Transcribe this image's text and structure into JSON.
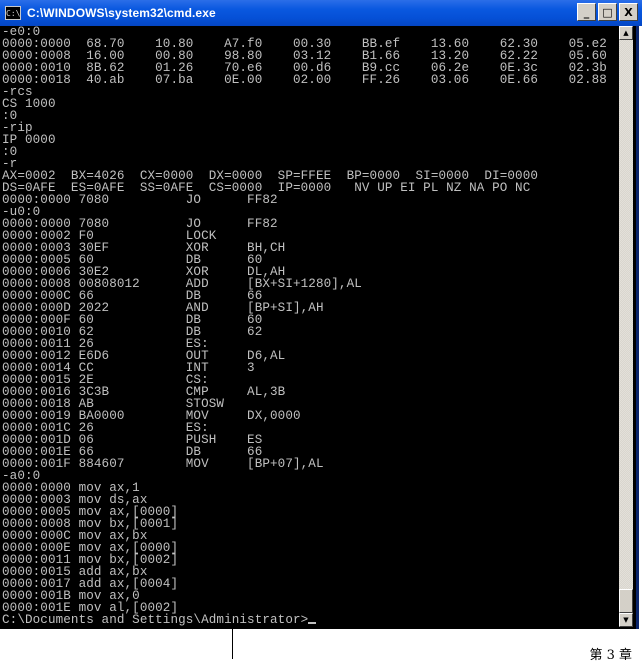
{
  "window": {
    "title": "C:\\WINDOWS\\system32\\cmd.exe",
    "icon_text": "C:\\",
    "buttons": [
      "_",
      "□",
      "X"
    ]
  },
  "console": {
    "lines": [
      "-e0:0",
      "0000:0000  68.70    10.80    A7.f0    00.30    BB.ef    13.60    62.30    05.e2",
      "0000:0008  16.00    00.80    98.80    03.12    B1.66    13.20    62.22    05.60",
      "0000:0010  8B.62    01.26    70.e6    00.d6    B9.cc    06.2e    0E.3c    02.3b",
      "0000:0018  40.ab    07.ba    0E.00    02.00    FF.26    03.06    0E.66    02.88",
      "-rcs",
      "CS 1000",
      ":0",
      "-rip",
      "IP 0000",
      ":0",
      "-r",
      "AX=0002  BX=4026  CX=0000  DX=0000  SP=FFEE  BP=0000  SI=0000  DI=0000",
      "DS=0AFE  ES=0AFE  SS=0AFE  CS=0000  IP=0000   NV UP EI PL NZ NA PO NC",
      "0000:0000 7080          JO      FF82",
      "-u0:0",
      "0000:0000 7080          JO      FF82",
      "0000:0002 F0            LOCK",
      "0000:0003 30EF          XOR     BH,CH",
      "0000:0005 60            DB      60",
      "0000:0006 30E2          XOR     DL,AH",
      "0000:0008 00808012      ADD     [BX+SI+1280],AL",
      "0000:000C 66            DB      66",
      "0000:000D 2022          AND     [BP+SI],AH",
      "0000:000F 60            DB      60",
      "0000:0010 62            DB      62",
      "0000:0011 26            ES:",
      "0000:0012 E6D6          OUT     D6,AL",
      "0000:0014 CC            INT     3",
      "0000:0015 2E            CS:",
      "0000:0016 3C3B          CMP     AL,3B",
      "0000:0018 AB            STOSW",
      "0000:0019 BA0000        MOV     DX,0000",
      "0000:001C 26            ES:",
      "0000:001D 06            PUSH    ES",
      "0000:001E 66            DB      66",
      "0000:001F 884607        MOV     [BP+07],AL",
      "-a0:0",
      "0000:0000 mov ax,1",
      "0000:0003 mov ds,ax",
      "0000:0005 mov ax,[0000]",
      "0000:0008 mov bx,[0001]",
      "0000:000C mov ax,bx",
      "0000:000E mov ax,[0000]",
      "0000:0011 mov bx,[0002]",
      "0000:0015 add ax,bx",
      "0000:0017 add ax,[0004]",
      "0000:001B mov ax,0",
      "0000:001E mov al,[0002]"
    ],
    "prompt": "C:\\Documents and Settings\\Administrator>"
  },
  "page": {
    "chapter_label": "第 3 章"
  },
  "colors": {
    "titlebar": "#0550d6",
    "console_bg": "#000000",
    "console_text": "#c0c0c0"
  }
}
